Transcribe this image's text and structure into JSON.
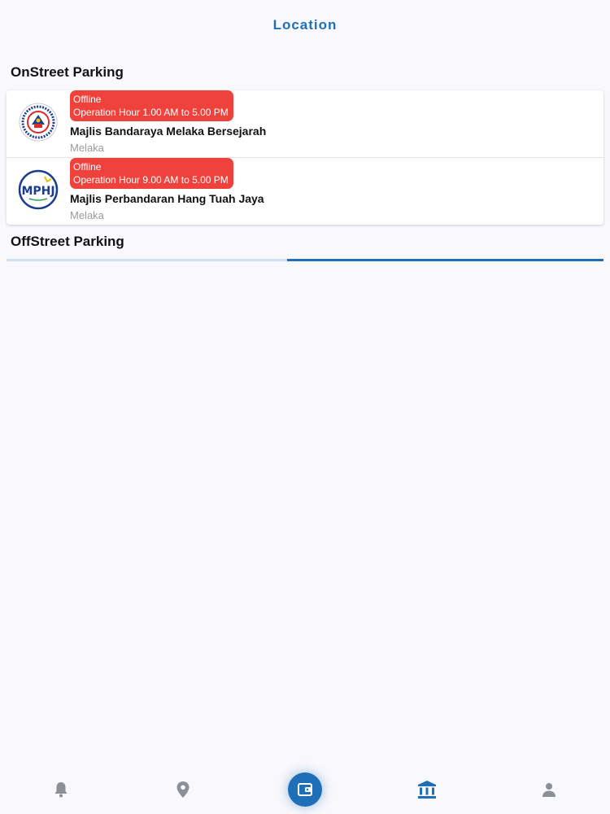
{
  "header": {
    "title": "Location"
  },
  "sections": {
    "onstreet": {
      "title": "OnStreet Parking"
    },
    "offstreet": {
      "title": "OffStreet Parking"
    }
  },
  "onstreet_items": [
    {
      "status": "Offline",
      "hours": "Operation Hour 1.00 AM to 5.00 PM",
      "name": "Majlis Bandaraya Melaka Bersejarah",
      "state": "Melaka"
    },
    {
      "status": "Offline",
      "hours": "Operation Hour 9.00 AM to 5.00 PM",
      "name": "Majlis Perbandaran Hang Tuah Jaya",
      "state": "Melaka"
    }
  ],
  "offstreet_loading": {
    "progress_fraction": 0.53
  },
  "logos": {
    "mphtj_text": "MPHJ"
  },
  "bottom_nav": {
    "items": [
      {
        "icon": "bell-icon"
      },
      {
        "icon": "location-pin-icon"
      },
      {
        "icon": "wallet-icon"
      },
      {
        "icon": "bank-icon"
      },
      {
        "icon": "user-icon"
      }
    ]
  },
  "colors": {
    "accent": "#1f6fb8",
    "badge": "#f0423d",
    "background": "#f9f8fc"
  }
}
